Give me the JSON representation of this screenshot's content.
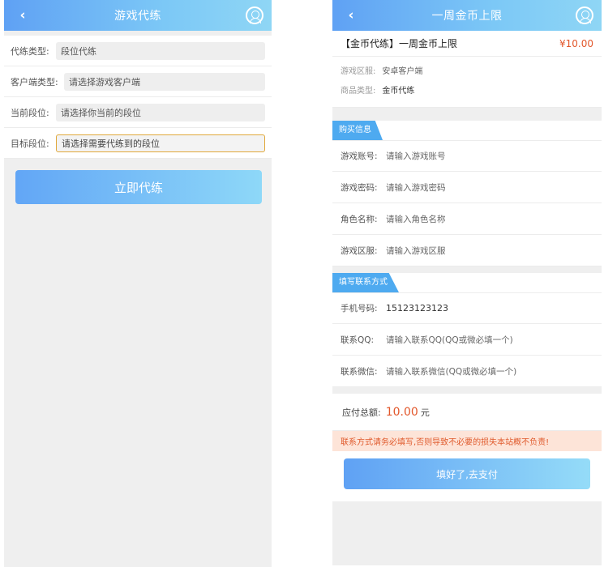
{
  "left": {
    "header": {
      "back": "‹",
      "title": "游戏代练"
    },
    "form": [
      {
        "label": "代练类型:",
        "value": "段位代练"
      },
      {
        "label": "客户端类型:",
        "value": "请选择游戏客户端"
      },
      {
        "label": "当前段位:",
        "value": "请选择你当前的段位"
      },
      {
        "label": "目标段位:",
        "value": "请选择需要代练到的段位"
      }
    ],
    "submit_label": "立即代练"
  },
  "right": {
    "header": {
      "back": "‹",
      "title": "一周金币上限"
    },
    "product": {
      "name": "【金币代练】一周金币上限",
      "price": "¥10.00"
    },
    "meta": [
      {
        "label": "游戏区服:",
        "value": "安卓客户端"
      },
      {
        "label": "商品类型:",
        "value": "金币代练"
      }
    ],
    "purchase_section": "购买信息",
    "purchase_fields": [
      {
        "label": "游戏账号:",
        "placeholder": "请输入游戏账号"
      },
      {
        "label": "游戏密码:",
        "placeholder": "请输入游戏密码"
      },
      {
        "label": "角色名称:",
        "placeholder": "请输入角色名称"
      },
      {
        "label": "游戏区服:",
        "placeholder": "请输入游戏区服"
      }
    ],
    "contact_section": "填写联系方式",
    "contact_fields": [
      {
        "label": "手机号码:",
        "value": "15123123123"
      },
      {
        "label": "联系QQ:",
        "placeholder": "请输入联系QQ(QQ或微必填一个)"
      },
      {
        "label": "联系微信:",
        "placeholder": "请输入联系微信(QQ或微必填一个)"
      }
    ],
    "total": {
      "label": "应付总额:",
      "amount": "10.00",
      "unit": "元"
    },
    "notice": "联系方式请务必填写,否则导致不必要的损失本站概不负责!",
    "pay_label": "填好了,去支付"
  },
  "colors": {
    "accent": "#5fa1f4",
    "price": "#e2572b",
    "notice_bg": "#fde4d8",
    "focus_border": "#e0a83a"
  }
}
